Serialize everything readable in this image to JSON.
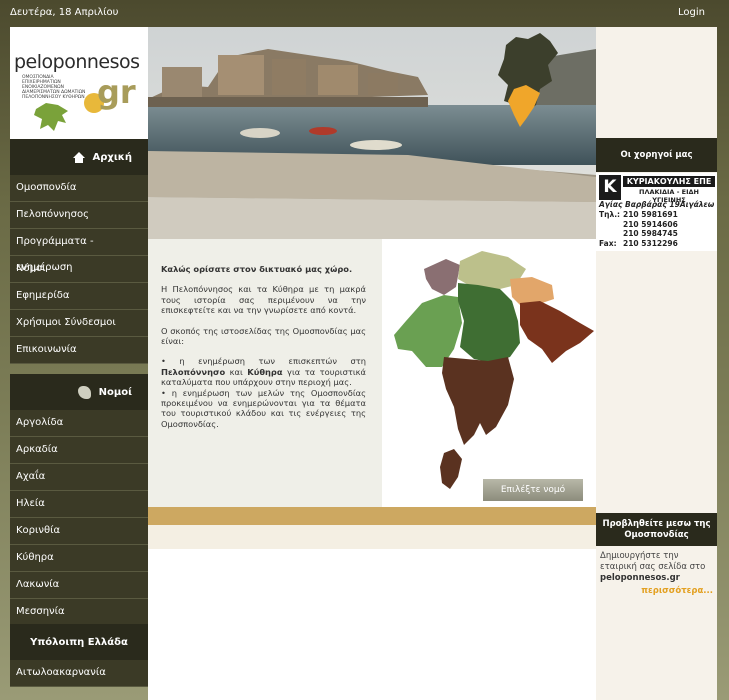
{
  "top": {
    "date": "Δευτέρα, 18 Απριλίου",
    "login": "Login"
  },
  "logo": {
    "name": "peloponnesos",
    "suffix": "gr",
    "subtitle": "ΟΜΟΣΠΟΝΔΙΑ ΕΠΙΧΕΙΡΗΜΑΤΙΩΝ ΕΝΟΙΚΙΑΖΟΜΕΝΩΝ ΔΙΑΜΕΡΙΣΜΑΤΩΝ ΔΩΜΑΤΙΩΝ ΠΕΛΟΠΟΝΝΗΣΟΥ ΚΥΘΗΡΩΝ"
  },
  "nav": {
    "home": "Αρχική",
    "items": [
      "Ομοσπονδία",
      "Πελοπόννησος",
      "Προγράμματα - ενημέρωση",
      "Νόμοι",
      "Εφημερίδα",
      "Χρήσιμοι Σύνδεσμοι",
      "Επικοινωνία"
    ],
    "prefectures_title": "Νομοί",
    "prefectures": [
      "Αργολίδα",
      "Αρκαδία",
      "Αχαΐα",
      "Ηλεία",
      "Κορινθία",
      "Κύθηρα",
      "Λακωνία",
      "Μεσσηνία"
    ],
    "rest_title": "Υπόλοιπη Ελλάδα",
    "rest": [
      "Αιτωλοακαρνανία"
    ]
  },
  "content": {
    "welcome": "Καλώς ορίσατε στον δικτυακό μας χώρο.",
    "p1": "Η Πελοπόννησος και τα Κύθηρα με τη μακρά τους ιστορία σας περιμένουν να την επισκεφτείτε και να την γνωρίσετε από κοντά.",
    "p2": "Ο σκοπός της ιστοσελίδας της Ομοσπονδίας μας είναι:",
    "b1_pre": "• η ενημέρωση των επισκεπτών στη ",
    "b1_strong1": "Πελοπόννησο",
    "b1_mid": " και ",
    "b1_strong2": "Κύθηρα",
    "b1_post": " για τα τουριστικά καταλύματα που υπάρχουν στην περιοχή μας.",
    "b2": "• η ενημέρωση των μελών της Ομοσπονδίας προκειμένου να ενημερώνονται για τα θέματα του τουριστικού κλάδου και τις ενέργειες της Ομοσπονδίας.",
    "select_button": "Επιλέξτε νομό"
  },
  "sidebar": {
    "sponsors_title": "Οι χορηγοί μας",
    "sponsor": {
      "logo_letter": "K",
      "name": "ΚΥΡΙΑΚΟΥΛΗΣ ΕΠΕ",
      "sub": "ΠΛΑΚΙΔΙΑ - ΕΙΔΗ ΥΓΙΕΙΝΗΣ",
      "address": "Αγίας Βαρβάρας 19Αιγάλεω",
      "phone_label": "Τηλ.:",
      "phones": [
        "210 5981691",
        "210 5914606",
        "210 5984745"
      ],
      "fax_label": "Fax:",
      "fax": "210 5312296"
    },
    "promo_title": "Προβληθείτε μεσω της Ομοσπονδίας",
    "promo_text": "Δημιουργήστε την εταιρική σας σελίδα στο",
    "promo_site": "peloponnesos.gr",
    "more": "περισσότερα..."
  },
  "colors": {
    "dark": "#2a2a1c",
    "nav": "#3b3a26",
    "accent": "#cda861",
    "link": "#e3a020"
  }
}
